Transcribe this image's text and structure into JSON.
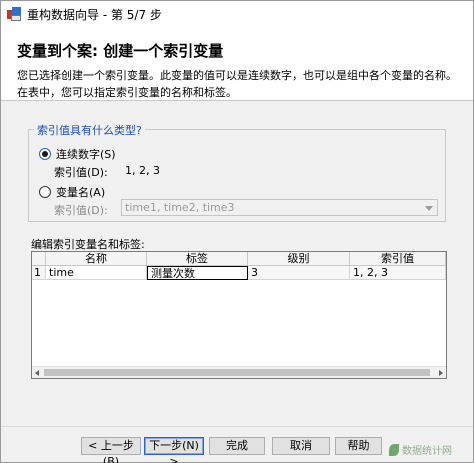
{
  "window": {
    "title": "重构数据向导 - 第 5/7 步"
  },
  "header": {
    "heading": "变量到个案: 创建一个索引变量",
    "line1": "您已选择创建一个索引变量。此变量的值可以是连续数字，也可以是组中各个变量的名称。",
    "line2": "在表中，您可以指定索引变量的名称和标签。"
  },
  "index_group": {
    "legend": "索引值具有什么类型?",
    "option_sequential": {
      "label": "连续数字(S)",
      "checked": true,
      "index_values_label": "索引值(D):",
      "index_values": "1, 2, 3"
    },
    "option_varnames": {
      "label": "变量名(A)",
      "checked": false,
      "index_values_label": "索引值(D):",
      "selected_value": "time1, time2, time3"
    }
  },
  "grid": {
    "label": "编辑索引变量名和标签:",
    "columns": [
      "名称",
      "标签",
      "级别",
      "索引值"
    ],
    "rows": [
      {
        "num": "1",
        "name": "time",
        "label": "测量次数",
        "level": "3",
        "index_values": "1, 2, 3"
      }
    ]
  },
  "buttons": {
    "back": "< 上一步(B)",
    "next": "下一步(N) >",
    "finish": "完成",
    "cancel": "取消",
    "help": "帮助"
  },
  "watermark": "数据统计网"
}
